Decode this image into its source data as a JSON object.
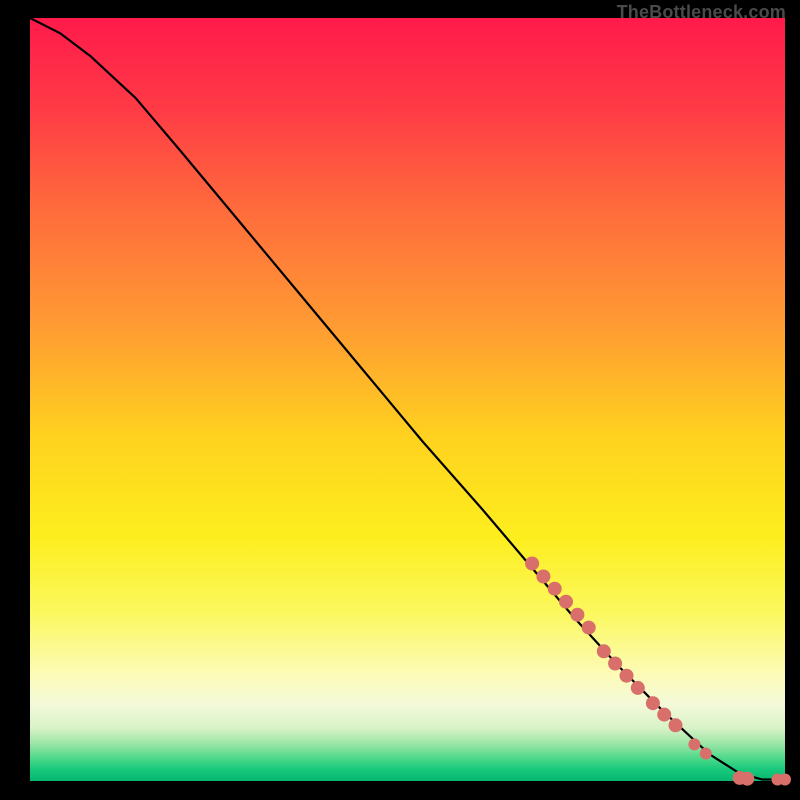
{
  "attribution": "TheBottleneck.com",
  "chart_data": {
    "type": "line",
    "title": "",
    "xlabel": "",
    "ylabel": "",
    "xlim": [
      0,
      100
    ],
    "ylim": [
      0,
      100
    ],
    "curve": [
      {
        "x": 0,
        "y": 100.0
      },
      {
        "x": 4,
        "y": 98.0
      },
      {
        "x": 8,
        "y": 95.0
      },
      {
        "x": 14,
        "y": 89.5
      },
      {
        "x": 20,
        "y": 82.5
      },
      {
        "x": 28,
        "y": 73.0
      },
      {
        "x": 36,
        "y": 63.5
      },
      {
        "x": 44,
        "y": 54.0
      },
      {
        "x": 52,
        "y": 44.5
      },
      {
        "x": 60,
        "y": 35.5
      },
      {
        "x": 66,
        "y": 28.5
      },
      {
        "x": 72,
        "y": 21.5
      },
      {
        "x": 78,
        "y": 15.0
      },
      {
        "x": 84,
        "y": 9.0
      },
      {
        "x": 90,
        "y": 3.5
      },
      {
        "x": 94,
        "y": 1.0
      },
      {
        "x": 97,
        "y": 0.2
      },
      {
        "x": 100,
        "y": 0.2
      }
    ],
    "series": [
      {
        "name": "markers",
        "color": "#d86f6a",
        "points": [
          {
            "x": 66.5,
            "y": 28.5,
            "r": 7
          },
          {
            "x": 68.0,
            "y": 26.8,
            "r": 7
          },
          {
            "x": 69.5,
            "y": 25.2,
            "r": 7
          },
          {
            "x": 71.0,
            "y": 23.5,
            "r": 7
          },
          {
            "x": 72.5,
            "y": 21.8,
            "r": 7
          },
          {
            "x": 74.0,
            "y": 20.1,
            "r": 7
          },
          {
            "x": 76.0,
            "y": 17.0,
            "r": 7
          },
          {
            "x": 77.5,
            "y": 15.4,
            "r": 7
          },
          {
            "x": 79.0,
            "y": 13.8,
            "r": 7
          },
          {
            "x": 80.5,
            "y": 12.2,
            "r": 7
          },
          {
            "x": 82.5,
            "y": 10.2,
            "r": 7
          },
          {
            "x": 84.0,
            "y": 8.7,
            "r": 7
          },
          {
            "x": 85.5,
            "y": 7.3,
            "r": 7
          },
          {
            "x": 88.0,
            "y": 4.8,
            "r": 6
          },
          {
            "x": 89.5,
            "y": 3.6,
            "r": 6
          },
          {
            "x": 94.0,
            "y": 0.4,
            "r": 7
          },
          {
            "x": 95.0,
            "y": 0.3,
            "r": 7
          },
          {
            "x": 99.0,
            "y": 0.2,
            "r": 6
          },
          {
            "x": 100.0,
            "y": 0.2,
            "r": 6
          }
        ]
      }
    ]
  }
}
